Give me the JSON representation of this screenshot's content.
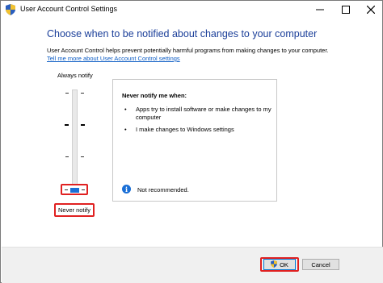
{
  "window": {
    "title": "User Account Control Settings"
  },
  "main": {
    "heading": "Choose when to be notified about changes to your computer",
    "description": "User Account Control helps prevent potentially harmful programs from making changes to your computer.",
    "link": "Tell me more about User Account Control settings"
  },
  "slider": {
    "top_label": "Always notify",
    "bottom_label": "Never notify",
    "level": 1,
    "levels": 4
  },
  "info": {
    "title": "Never notify me when:",
    "bullets": [
      "Apps try to install software or make changes to my computer",
      "I make changes to Windows settings"
    ],
    "note": "Not recommended."
  },
  "footer": {
    "ok_label": "OK",
    "cancel_label": "Cancel"
  },
  "colors": {
    "heading": "#1a3e99",
    "link": "#0b5bc4",
    "highlight": "#e02020",
    "accent": "#1a6fd6"
  },
  "icons": {
    "title": "uac-shield-icon",
    "info": "info-icon",
    "ok": "uac-shield-icon"
  }
}
